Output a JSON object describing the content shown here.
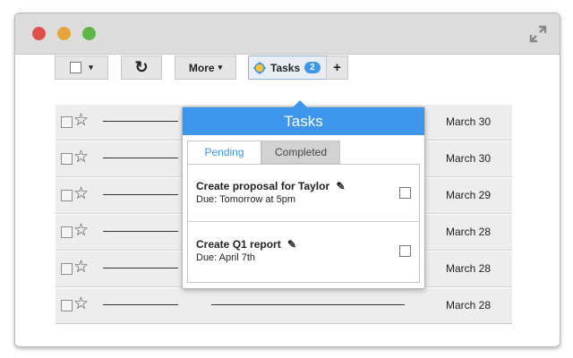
{
  "toolbar": {
    "more_label": "More",
    "more_caret": "▾",
    "select_caret": "▾",
    "refresh_glyph": "↻",
    "tasks_label": "Tasks",
    "tasks_count": "2",
    "add_glyph": "+"
  },
  "rows": [
    {
      "date": "March 30"
    },
    {
      "date": "March 30"
    },
    {
      "date": "March 29"
    },
    {
      "date": "March 28"
    },
    {
      "date": "March 28"
    },
    {
      "date": "March 28"
    }
  ],
  "popup": {
    "title": "Tasks",
    "tabs": [
      {
        "label": "Pending",
        "active": true
      },
      {
        "label": "Completed",
        "active": false
      }
    ],
    "tasks": [
      {
        "title": "Create proposal for Taylor",
        "due": "Due: Tomorrow at 5pm"
      },
      {
        "title": "Create Q1 report",
        "due": "Due: April 7th"
      }
    ]
  },
  "colors": {
    "accent": "#3d95ec",
    "close": "#e0504a",
    "minimize": "#e8a23a",
    "maximize": "#5fb648"
  },
  "icons": {
    "star": "☆",
    "pencil": "✎"
  }
}
